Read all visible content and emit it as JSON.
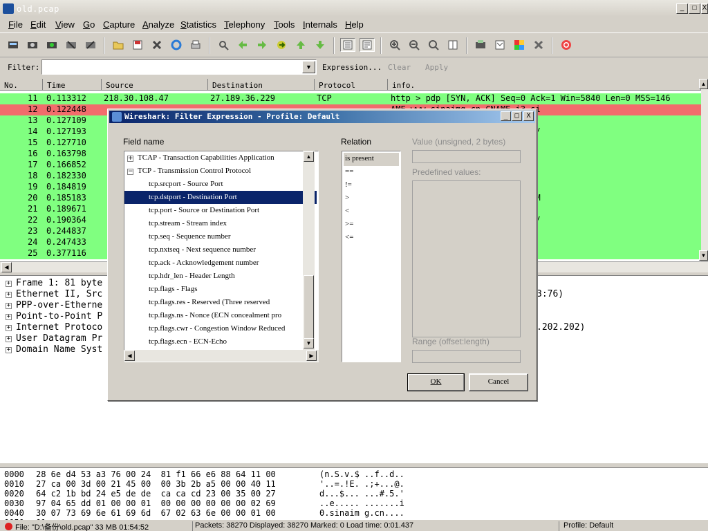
{
  "window": {
    "title": "old.pcap",
    "min": "_",
    "max": "□",
    "close": "X"
  },
  "menu": [
    "File",
    "Edit",
    "View",
    "Go",
    "Capture",
    "Analyze",
    "Statistics",
    "Telephony",
    "Tools",
    "Internals",
    "Help"
  ],
  "filter": {
    "label": "Filter:",
    "value": "",
    "expression": "Expression...",
    "clear": "Clear",
    "apply": "Apply"
  },
  "columns": [
    "No.",
    "Time",
    "Source",
    "Destination",
    "Protocol",
    "info."
  ],
  "packets": [
    {
      "no": "11",
      "time": "0.113312",
      "src": "218.30.108.47",
      "dst": "27.189.36.229",
      "proto": "TCP",
      "info": "http > pdp [SYN, ACK] Seq=0 Ack=1 Win=5840 Len=0 MSS=146",
      "color": "#80ff80"
    },
    {
      "no": "12",
      "time": "0.122448",
      "src": "",
      "dst": "",
      "proto": "",
      "info": "AME www.sinaimg.cn CNAME i3.si",
      "color": "#f26c6c"
    },
    {
      "no": "13",
      "time": "0.127109",
      "src": "",
      "dst": "",
      "proto": "",
      "info": "=1 Win=65535 Len=0",
      "color": "#80ff80"
    },
    {
      "no": "14",
      "time": "0.127193",
      "src": "",
      "dst": "",
      "proto": "",
      "info": "t090213img/shanghai3.gif HTTP/",
      "color": "#80ff80"
    },
    {
      "no": "15",
      "time": "0.127710",
      "src": "",
      "dst": "",
      "proto": "",
      "info": "0 Win=65535 Len=0 MSS=1440 WS",
      "color": "#80ff80"
    },
    {
      "no": "16",
      "time": "0.163798",
      "src": "",
      "dst": "",
      "proto": "",
      "info": "Ack=364 Win=6912 Len=0",
      "color": "#80ff80"
    },
    {
      "no": "17",
      "time": "0.166852",
      "src": "",
      "dst": "",
      "proto": "",
      "info": "",
      "color": "#80ff80"
    },
    {
      "no": "18",
      "time": "0.182330",
      "src": "",
      "dst": "",
      "proto": "",
      "info": "=364 Win=6912 Len=0",
      "color": "#80ff80"
    },
    {
      "no": "19",
      "time": "0.184819",
      "src": "",
      "dst": "",
      "proto": "",
      "info": "",
      "color": "#80ff80"
    },
    {
      "no": "20",
      "time": "0.185183",
      "src": "",
      "dst": "",
      "proto": "",
      "info": "] Seq=0 Ack=1 Win=5840 Len=0 M",
      "color": "#80ff80"
    },
    {
      "no": "21",
      "time": "0.189671",
      "src": "",
      "dst": "",
      "proto": "",
      "info": "=1 Ack=1 Win=65535 Len=0",
      "color": "#80ff80"
    },
    {
      "no": "22",
      "time": "0.190364",
      "src": "",
      "dst": "",
      "proto": "",
      "info": "t090213img/shanghai5.gif HTTP/",
      "color": "#80ff80"
    },
    {
      "no": "23",
      "time": "0.244837",
      "src": "",
      "dst": "",
      "proto": "",
      "info": "=1 Ack=364 Win=6912 Len=0",
      "color": "#80ff80"
    },
    {
      "no": "24",
      "time": "0.247433",
      "src": "",
      "dst": "",
      "proto": "",
      "info": "",
      "color": "#80ff80"
    },
    {
      "no": "25",
      "time": "0.377116",
      "src": "",
      "dst": "",
      "proto": "",
      "info": "=364 Ack=642 Win=64894 Len=0",
      "color": "#80ff80"
    }
  ],
  "details": [
    {
      "label": "Frame 1: 81 byte",
      "right": ""
    },
    {
      "label": "Ethernet II, Src",
      "right": "3:76)"
    },
    {
      "label": "PPP-over-Etherne",
      "right": ""
    },
    {
      "label": "Point-to-Point P",
      "right": ""
    },
    {
      "label": "Internet Protoco",
      "right": ".202.202)"
    },
    {
      "label": "User Datagram Pr",
      "right": ""
    },
    {
      "label": "Domain Name Syst",
      "right": ""
    }
  ],
  "bytes": [
    {
      "off": "0000",
      "hex": "28 6e d4 53 a3 76 00 24  81 f1 66 e6 88 64 11 00",
      "ascii": "(n.S.v.$ ..f..d.."
    },
    {
      "off": "0010",
      "hex": "27 ca 00 3d 00 21 45 00  00 3b 2b a5 00 00 40 11",
      "ascii": "'..=.!E. .;+...@."
    },
    {
      "off": "0020",
      "hex": "64 c2 1b bd 24 e5 de de  ca ca cd 23 00 35 00 27",
      "ascii": "d...$... ...#.5.'"
    },
    {
      "off": "0030",
      "hex": "97 04 65 dd 01 00 00 01  00 00 00 00 00 00 02 69",
      "ascii": "..e..... .......i"
    },
    {
      "off": "0040",
      "hex": "30 07 73 69 6e 61 69 6d  67 02 63 6e 00 00 01 00",
      "ascii": "0.sinaim g.cn...."
    },
    {
      "off": "0050",
      "hex": "01",
      "ascii": ""
    }
  ],
  "status": {
    "file": "File: \"D:\\备份\\old.pcap\" 33 MB 01:54:52",
    "packets": "Packets: 38270 Displayed: 38270 Marked: 0 Load time: 0:01.437",
    "profile": "Profile: Default"
  },
  "dialog": {
    "title": "Wireshark: Filter Expression - Profile: Default",
    "field_label": "Field name",
    "relation_label": "Relation",
    "value_label": "Value (unsigned, 2 bytes)",
    "predefined_label": "Predefined values:",
    "range_label": "Range (offset:length)",
    "ok": "OK",
    "cancel": "Cancel",
    "fields": [
      {
        "text": "TCAP - Transaction Capabilities Application",
        "type": "parent",
        "ex": "+"
      },
      {
        "text": "TCP - Transmission Control Protocol",
        "type": "parent",
        "ex": "−"
      },
      {
        "text": "tcp.srcport - Source Port",
        "type": "child"
      },
      {
        "text": "tcp.dstport - Destination Port",
        "type": "child",
        "selected": true
      },
      {
        "text": "tcp.port - Source or Destination Port",
        "type": "child"
      },
      {
        "text": "tcp.stream - Stream index",
        "type": "child"
      },
      {
        "text": "tcp.seq - Sequence number",
        "type": "child"
      },
      {
        "text": "tcp.nxtseq - Next sequence number",
        "type": "child"
      },
      {
        "text": "tcp.ack - Acknowledgement number",
        "type": "child"
      },
      {
        "text": "tcp.hdr_len - Header Length",
        "type": "child"
      },
      {
        "text": "tcp.flags - Flags",
        "type": "child"
      },
      {
        "text": "tcp.flags.res - Reserved (Three reserved",
        "type": "child"
      },
      {
        "text": "tcp.flags.ns - Nonce (ECN concealment pro",
        "type": "child"
      },
      {
        "text": "tcp.flags.cwr - Congestion Window Reduced",
        "type": "child"
      },
      {
        "text": "tcp.flags.ecn - ECN-Echo",
        "type": "child"
      }
    ],
    "relations": [
      "is present",
      "==",
      "!=",
      ">",
      "<",
      ">=",
      "<="
    ]
  }
}
